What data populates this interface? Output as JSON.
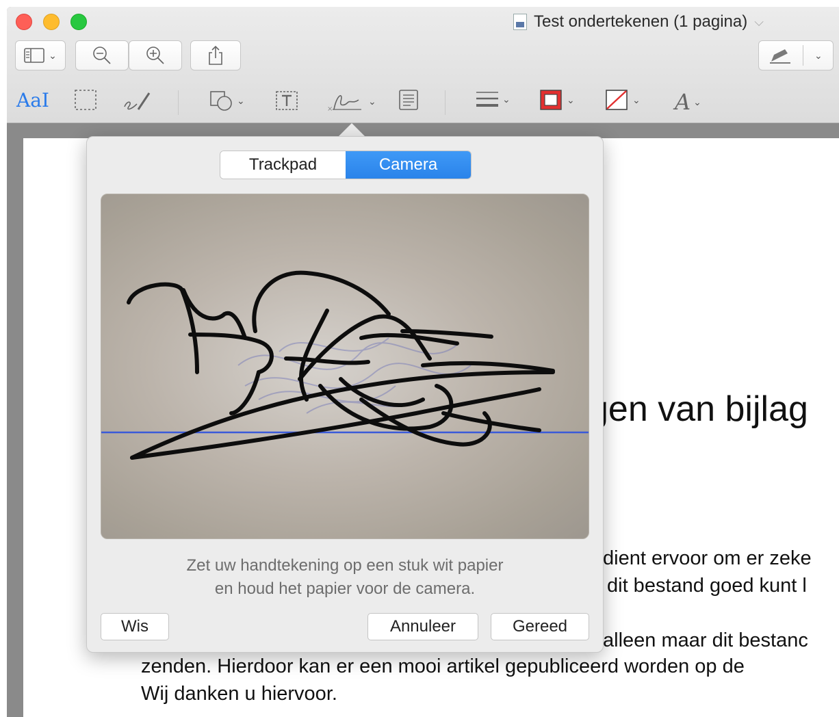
{
  "window": {
    "title": "Test ondertekenen (1 pagina)"
  },
  "toolbar": {
    "sidebar_button": "sidebar-toggle",
    "zoom_out": "zoom-out",
    "zoom_in": "zoom-in",
    "share": "share",
    "markup": "markup"
  },
  "markup_toolbar": {
    "text_select": "AaI"
  },
  "signature_popover": {
    "tabs": [
      "Trackpad",
      "Camera"
    ],
    "active_tab": "Camera",
    "hint_line1": "Zet uw handtekening op een stuk wit papier",
    "hint_line2": "en houd het papier voor de camera.",
    "clear_button": "Wis",
    "cancel_button": "Annuleer",
    "done_button": "Gereed"
  },
  "document": {
    "heading_fragment": "gen van bijlag",
    "line1": "dient ervoor om er zeke",
    "line2": "dit bestand goed kunt l",
    "line3": "alleen maar dit bestanc",
    "line4": "zenden. Hierdoor kan er een mooi artikel gepubliceerd worden op de",
    "line5": "Wij danken u hiervoor."
  },
  "colors": {
    "accent": "#2a83ea",
    "red_traffic": "#fe5f57",
    "yellow_traffic": "#febc2e",
    "green_traffic": "#28c840",
    "baseline": "#3a5ad9"
  }
}
